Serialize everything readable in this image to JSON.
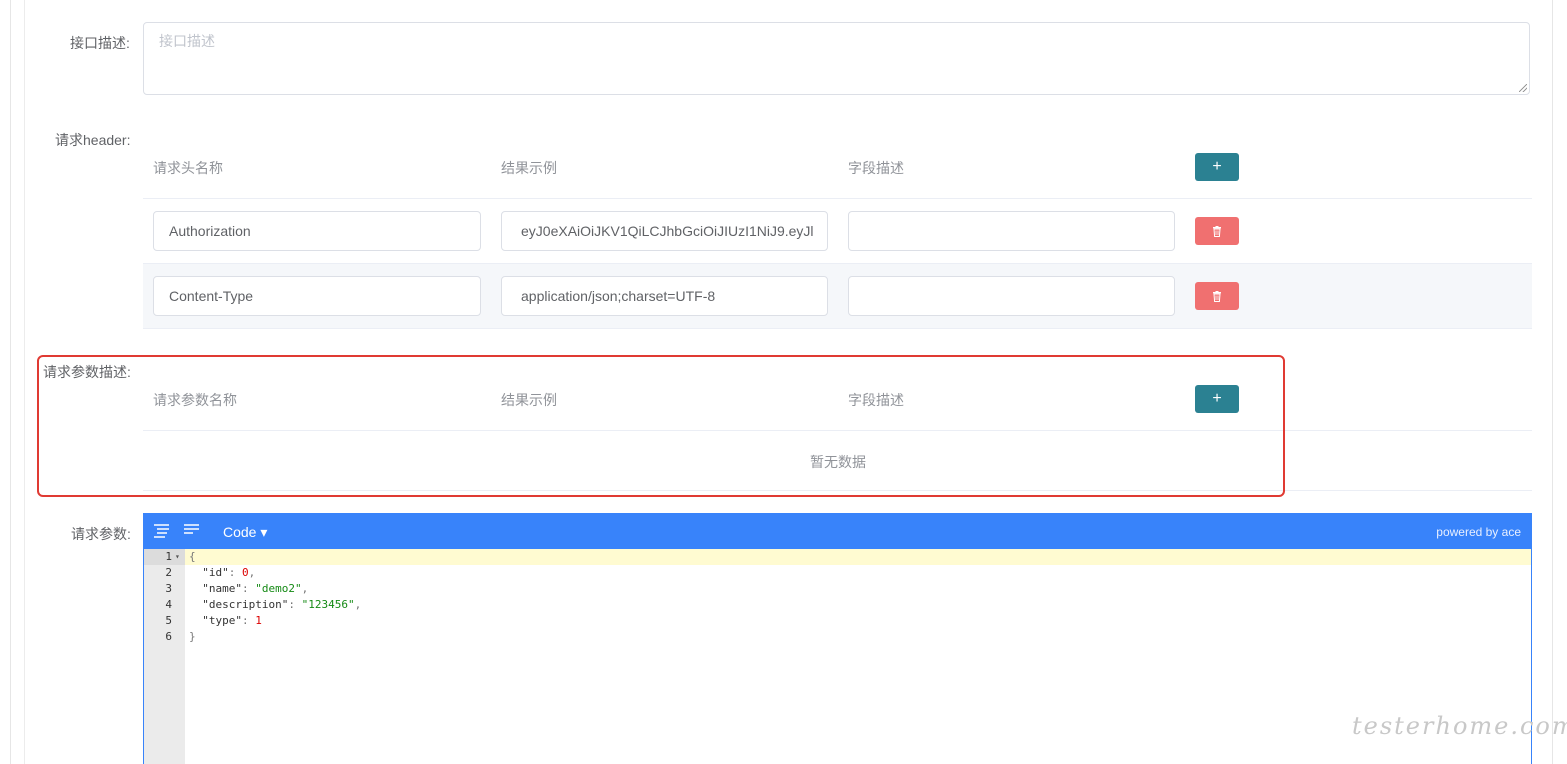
{
  "form": {
    "desc_label": "接口描述:",
    "desc_placeholder": "接口描述",
    "header_label": "请求header:",
    "params_desc_label": "请求参数描述:",
    "params_label": "请求参数:"
  },
  "header_table": {
    "col_name": "请求头名称",
    "col_example": "结果示例",
    "col_desc": "字段描述",
    "add_button": "+",
    "rows": [
      {
        "name": "Authorization",
        "example": "eyJ0eXAiOiJKV1QiLCJhbGciOiJIUzI1NiJ9.eyJl",
        "desc": ""
      },
      {
        "name": "Content-Type",
        "example": "application/json;charset=UTF-8",
        "desc": ""
      }
    ]
  },
  "params_table": {
    "col_name": "请求参数名称",
    "col_example": "结果示例",
    "col_desc": "字段描述",
    "add_button": "+",
    "empty_text": "暂无数据"
  },
  "editor": {
    "mode_label": "Code ▾",
    "powered_by": "powered by ace",
    "line_numbers": [
      "1",
      "2",
      "3",
      "4",
      "5",
      "6"
    ],
    "fold_marker": "▾",
    "lines": [
      {
        "text": "{"
      },
      {
        "key": "\"id\"",
        "sep": ": ",
        "value": "0",
        "type": "number",
        "trail": ","
      },
      {
        "key": "\"name\"",
        "sep": ": ",
        "value": "\"demo2\"",
        "type": "string",
        "trail": ","
      },
      {
        "key": "\"description\"",
        "sep": ": ",
        "value": "\"123456\"",
        "type": "string",
        "trail": ","
      },
      {
        "key": "\"type\"",
        "sep": ": ",
        "value": "1",
        "type": "number",
        "trail": ""
      },
      {
        "text": "}"
      }
    ]
  },
  "watermark": "testerhome.com",
  "colors": {
    "editor_bar": "#3883fa",
    "add_button": "#2b8192",
    "delete_button": "#f07070",
    "highlight_box": "#e03a33"
  },
  "icons": {
    "format": "format-icon",
    "compact": "compact-icon",
    "delete": "trash-icon",
    "add": "plus-icon"
  }
}
